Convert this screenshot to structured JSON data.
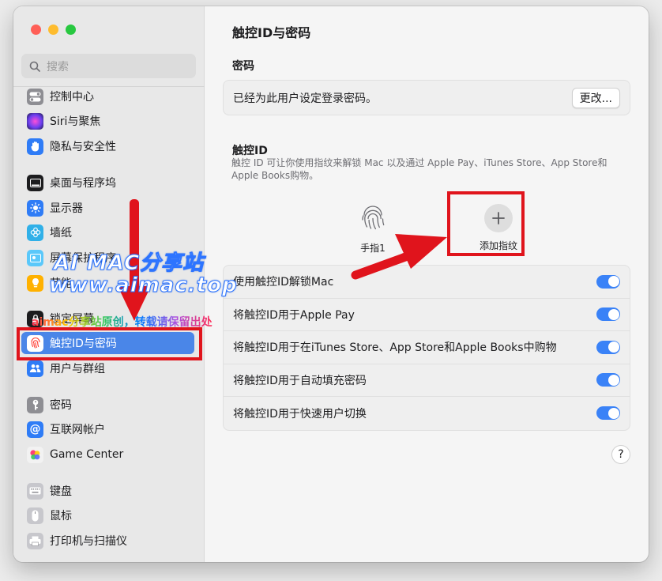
{
  "window": {
    "title": "触控ID与密码"
  },
  "colors": {
    "accent": "#3a82f7",
    "sidebar_active": "#4a86e8",
    "annotation": "#e0141c"
  },
  "search": {
    "placeholder": "搜索",
    "icon": "search-icon"
  },
  "sidebar": {
    "items": [
      {
        "label": "控制中心",
        "icon": "toggle-switches-icon",
        "color": "#8e8e93"
      },
      {
        "label": "Siri与聚焦",
        "icon": "siri-icon",
        "color": "#7b3fe4"
      },
      {
        "label": "隐私与安全性",
        "icon": "hand-icon",
        "color": "#2f7cf6"
      },
      {
        "label": "桌面与程序坞",
        "icon": "dock-icon",
        "color": "#1c1c1e"
      },
      {
        "label": "显示器",
        "icon": "sun-icon",
        "color": "#2f7cf6"
      },
      {
        "label": "墙纸",
        "icon": "flower-icon",
        "color": "#30b0e8"
      },
      {
        "label": "屏幕保护程序",
        "icon": "screensaver-icon",
        "color": "#5ac8fa"
      },
      {
        "label": "节能",
        "icon": "bulb-icon",
        "color": "#ffb100"
      },
      {
        "label": "锁定屏幕",
        "icon": "lock-screen-icon",
        "color": "#1c1c1e"
      },
      {
        "label": "触控ID与密码",
        "icon": "fingerprint-icon",
        "color": "#ff3b30",
        "active": true
      },
      {
        "label": "用户与群组",
        "icon": "users-icon",
        "color": "#2f7cf6"
      },
      {
        "label": "密码",
        "icon": "key-icon",
        "color": "#8e8e93"
      },
      {
        "label": "互联网帐户",
        "icon": "at-icon",
        "color": "#2f7cf6"
      },
      {
        "label": "Game Center",
        "icon": "game-center-icon",
        "color": "#e0e0e0"
      },
      {
        "label": "键盘",
        "icon": "keyboard-icon",
        "color": "#c7c7cc"
      },
      {
        "label": "鼠标",
        "icon": "mouse-icon",
        "color": "#c7c7cc"
      },
      {
        "label": "打印机与扫描仪",
        "icon": "printer-icon",
        "color": "#c7c7cc"
      }
    ]
  },
  "password": {
    "section_title": "密码",
    "status_text": "已经为此用户设定登录密码。",
    "change_button": "更改..."
  },
  "touch_id": {
    "section_title": "触控ID",
    "description": "触控 ID 可让你使用指纹来解锁 Mac 以及通过 Apple Pay、iTunes Store、App Store和 Apple Books购物。",
    "finger1_label": "手指1",
    "add_fingerprint_label": "添加指纹"
  },
  "settings": [
    {
      "label": "使用触控ID解锁Mac",
      "on": true
    },
    {
      "label": "将触控ID用于Apple Pay",
      "on": true
    },
    {
      "label": "将触控ID用于在iTunes Store、App Store和Apple Books中购物",
      "on": true
    },
    {
      "label": "将触控ID用于自动填充密码",
      "on": true
    },
    {
      "label": "将触控ID用于快速用户切换",
      "on": true
    }
  ],
  "help_button": "?",
  "watermark": {
    "title": "AI MAC分享站",
    "url": "www.aimac.top",
    "note": "aimac分享站原创，转载请保留出处"
  }
}
